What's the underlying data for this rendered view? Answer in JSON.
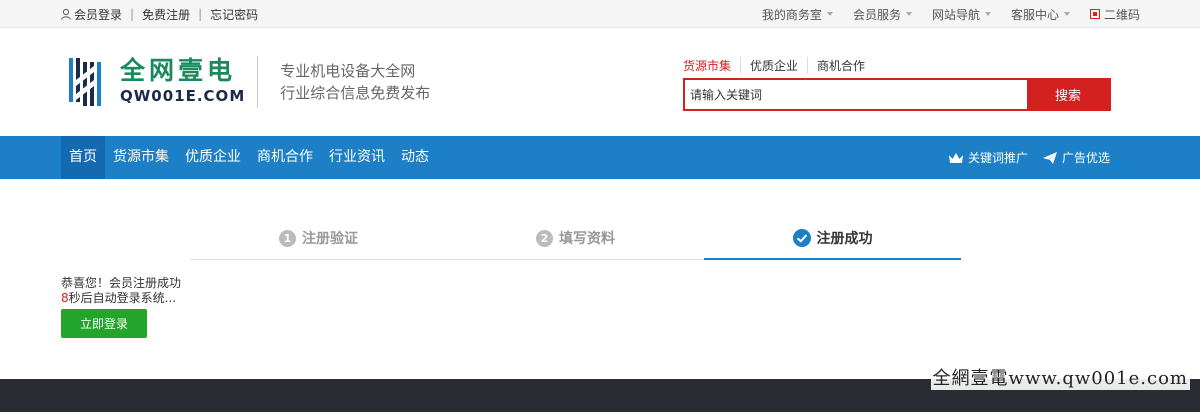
{
  "topbar": {
    "login": "会员登录",
    "register": "免费注册",
    "forgot": "忘记密码",
    "menus": [
      "我的商务室",
      "会员服务",
      "网站导航",
      "客服中心"
    ],
    "qrcode": "二维码"
  },
  "logo": {
    "cn": "全网壹电",
    "en": "QW001E.COM",
    "slogan1": "专业机电设备大全网",
    "slogan2": "行业综合信息免费发布"
  },
  "search": {
    "tabs": [
      "货源市集",
      "优质企业",
      "商机合作"
    ],
    "placeholder": "请输入关键词",
    "button": "搜索"
  },
  "nav": {
    "items": [
      "首页",
      "货源市集",
      "优质企业",
      "商机合作",
      "行业资讯",
      "动态"
    ],
    "right": [
      "关键词推广",
      "广告优选"
    ]
  },
  "steps": [
    {
      "num": "1",
      "label": "注册验证"
    },
    {
      "num": "2",
      "label": "填写资料"
    },
    {
      "num": "",
      "label": "注册成功"
    }
  ],
  "success": {
    "line1": "恭喜您！会员注册成功",
    "count": "8",
    "line2_suffix": "秒后自动登录系统...",
    "button": "立即登录"
  },
  "watermark": "全網壹電www.qw001e.com",
  "colors": {
    "brand_blue": "#1d80c6",
    "brand_red": "#d3211f",
    "brand_green": "#22a52a"
  }
}
